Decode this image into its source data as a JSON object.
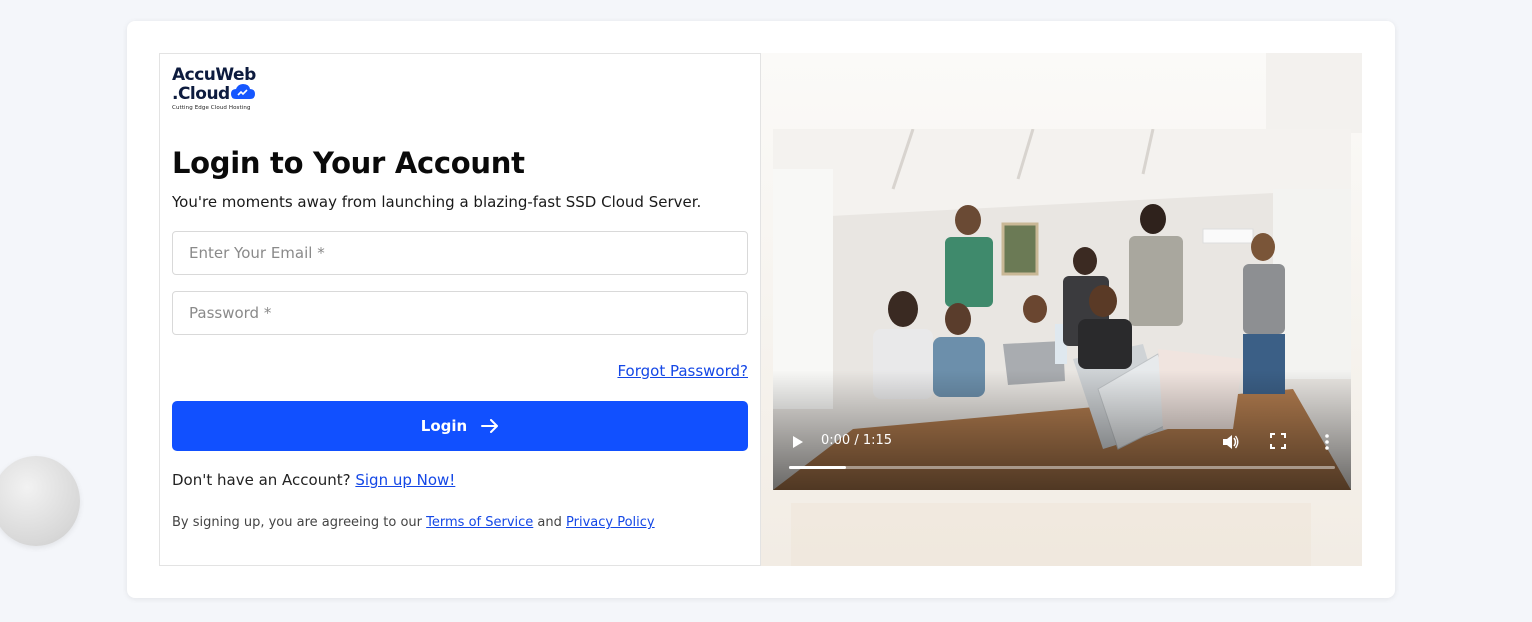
{
  "brand": {
    "line1": "AccuWeb",
    "line2": ".Cloud",
    "tagline": "Cutting Edge Cloud Hosting"
  },
  "login": {
    "heading": "Login to Your Account",
    "subtitle": "You're moments away from launching a blazing-fast SSD Cloud Server.",
    "email_placeholder": "Enter Your Email *",
    "password_placeholder": "Password *",
    "forgot_label": "Forgot Password?",
    "button_label": "Login",
    "signup_prompt": "Don't have an Account?",
    "signup_link": "Sign up Now!",
    "terms_prefix": "By signing up, you are agreeing to our",
    "terms_link": "Terms of Service",
    "terms_and": "and",
    "privacy_link": "Privacy Policy"
  },
  "video": {
    "time": "0:00 / 1:15",
    "progress_fraction": 0.105
  },
  "colors": {
    "accent": "#1150ff",
    "link": "#1447e6"
  },
  "icons": {
    "button": "arrow-right-icon",
    "play": "play-icon",
    "volume": "volume-icon",
    "fullscreen": "fullscreen-icon",
    "more": "more-vertical-icon"
  }
}
